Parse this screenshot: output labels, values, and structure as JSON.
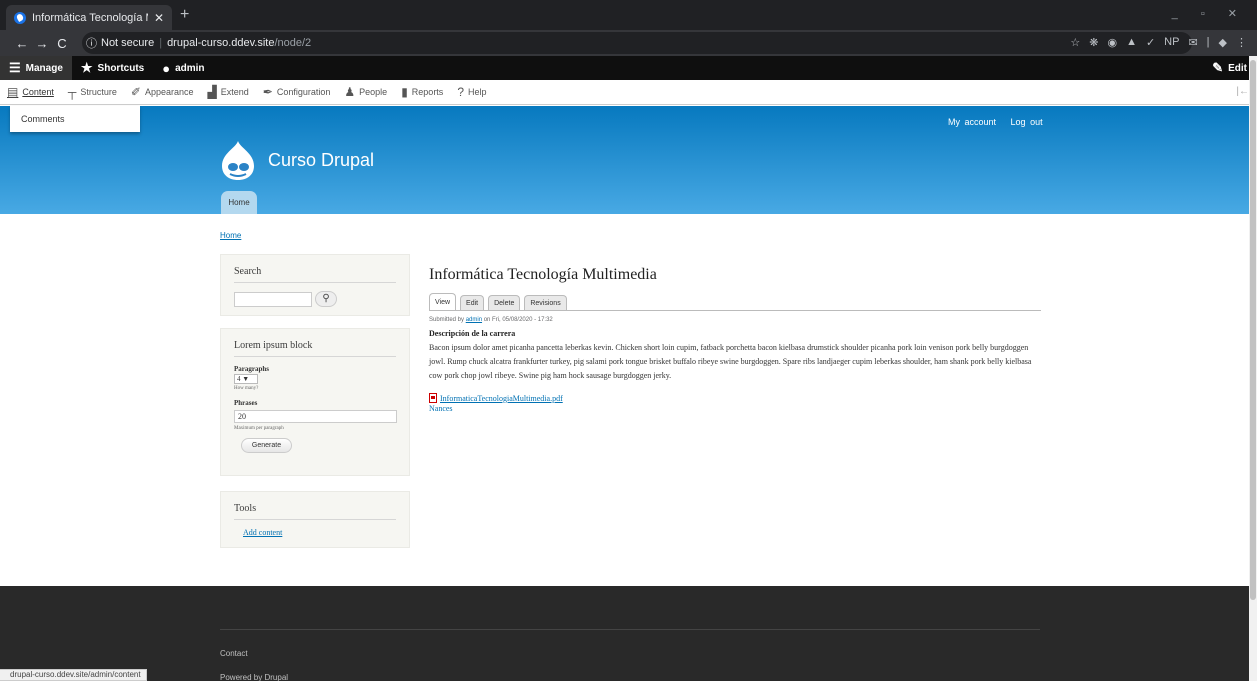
{
  "browser": {
    "tab_title": "Informática Tecnología Multim",
    "tab_close": "✕",
    "new_tab": "+",
    "window_controls": "_ ▫ ✕",
    "nav": {
      "back": "←",
      "forward": "→",
      "reload": "C"
    },
    "omnibox": {
      "info_icon": "ⓘ",
      "security": "Not secure",
      "separator": "|",
      "host": "drupal-curso.ddev.site",
      "path": "/node/2"
    },
    "toolbar_icons": [
      "☆",
      "❋",
      "◉",
      "▲",
      "✓",
      "NP",
      "✉",
      "|",
      "◆",
      "⋮"
    ]
  },
  "admin_toolbar": {
    "items": [
      {
        "icon": "☰",
        "label": "Manage"
      },
      {
        "icon": "★",
        "label": "Shortcuts"
      },
      {
        "icon": "●",
        "label": "admin"
      }
    ],
    "edit": {
      "icon": "✎",
      "label": "Edit"
    }
  },
  "tray": {
    "items": [
      {
        "icon": "▤",
        "label": "Content"
      },
      {
        "icon": "┬",
        "label": "Structure"
      },
      {
        "icon": "✐",
        "label": "Appearance"
      },
      {
        "icon": "▟",
        "label": "Extend"
      },
      {
        "icon": "✒",
        "label": "Configuration"
      },
      {
        "icon": "♟",
        "label": "People"
      },
      {
        "icon": "▮",
        "label": "Reports"
      },
      {
        "icon": "?",
        "label": "Help"
      }
    ],
    "collapse": "|←"
  },
  "dropdown": {
    "item": "Comments"
  },
  "header": {
    "user_links": [
      "My account",
      "Log out"
    ],
    "site_name": "Curso Drupal",
    "home_tab": "Home"
  },
  "breadcrumb": "Home",
  "sidebar": {
    "search": {
      "title": "Search",
      "button_icon": "⚲"
    },
    "lorem": {
      "title": "Lorem ipsum block",
      "paragraphs_label": "Paragraphs",
      "paragraphs_value": "4 ▼",
      "paragraphs_desc": "How many?",
      "phrases_label": "Phrases",
      "phrases_value": "20",
      "phrases_desc": "Maximum per paragraph",
      "generate": "Generate"
    },
    "tools": {
      "title": "Tools",
      "link": "Add content"
    }
  },
  "main": {
    "title": "Informática Tecnología Multimedia",
    "tabs": [
      "View",
      "Edit",
      "Delete",
      "Revisions"
    ],
    "submitted_prefix": "Submitted by",
    "author": "admin",
    "submitted_suffix": "on Fri, 05/08/2020 - 17:32",
    "field_label": "Descripción de la carrera",
    "body": "Bacon ipsum dolor amet picanha pancetta leberkas kevin. Chicken short loin cupim, fatback porchetta bacon kielbasa drumstick shoulder picanha pork loin venison pork belly burgdoggen jowl. Rump chuck alcatra frankfurter turkey, pig salami pork tongue brisket buffalo ribeye swine burgdoggen. Spare ribs landjaeger cupim leberkas shoulder, ham shank pork belly kielbasa cow pork chop jowl ribeye. Swine pig ham hock sausage burgdoggen jerky.",
    "file": "InformaticaTecnologiaMultimedia.pdf",
    "tag": "Nances"
  },
  "footer": {
    "contact": "Contact",
    "powered_prefix": "Powered by",
    "powered_link": "Drupal"
  },
  "status_url": "drupal-curso.ddev.site/admin/content"
}
